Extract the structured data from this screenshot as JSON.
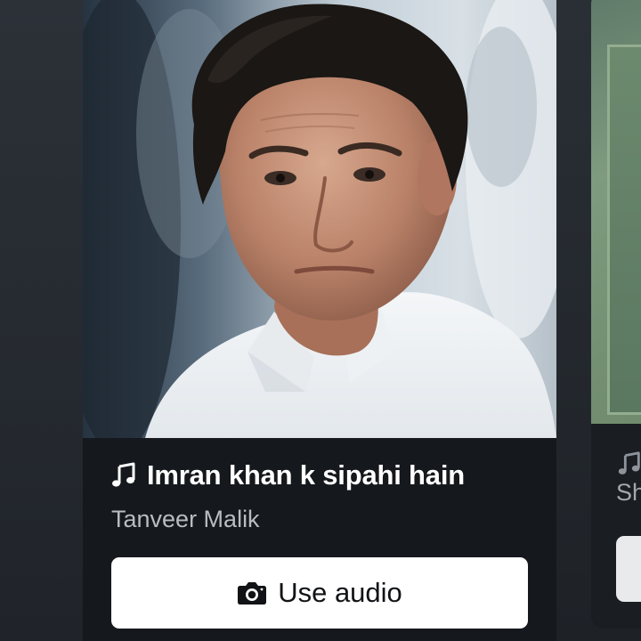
{
  "audio_card": {
    "image_icon": "portrait-photo",
    "title_icon": "music-note-icon",
    "title": "Imran khan k sipahi hain",
    "artist": "Tanveer Malik",
    "use_button": {
      "icon": "camera-icon",
      "label": "Use audio"
    }
  },
  "next_card": {
    "title_icon": "music-note-icon",
    "artist_partial": "Sh"
  },
  "colors": {
    "background": "#22262c",
    "card": "#15181c",
    "title_text": "#ffffff",
    "artist_text": "#b9bdc3",
    "button_bg": "#ffffff",
    "button_text": "#111316"
  }
}
